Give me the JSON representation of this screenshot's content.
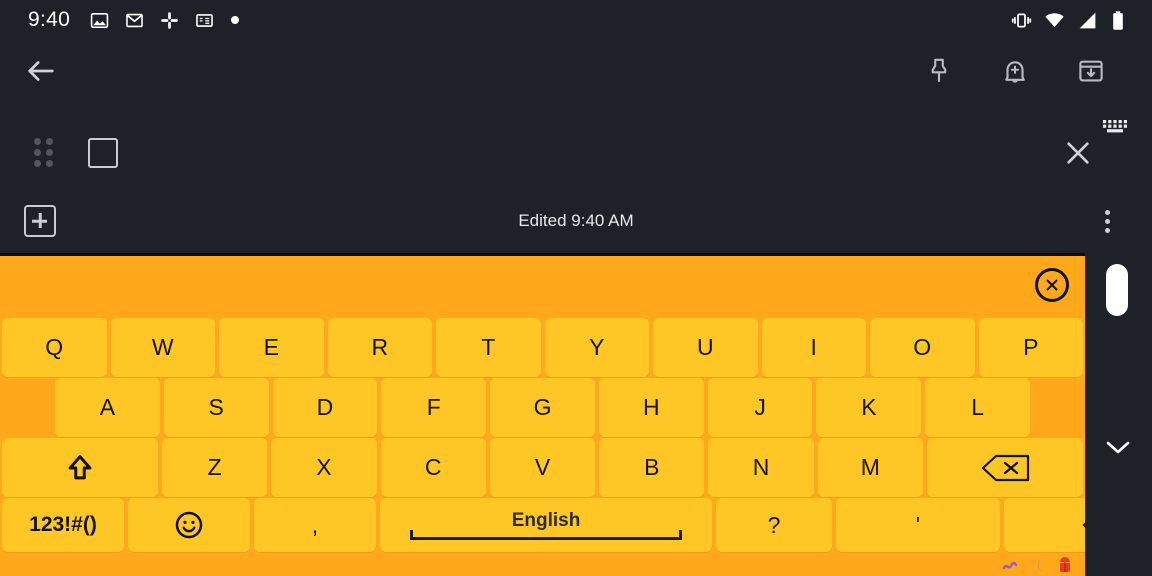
{
  "statusbar": {
    "time": "9:40",
    "left_icons": [
      "photos-icon",
      "gmail-icon",
      "slack-icon",
      "google-news-icon",
      "dot-icon"
    ],
    "right_icons": [
      "vibrate-icon",
      "wifi-icon",
      "cellular-signal-icon",
      "battery-icon"
    ]
  },
  "appbar": {
    "back_icon": "back-arrow-icon",
    "actions": [
      "pin-icon",
      "add-reminder-bell-icon",
      "archive-icon"
    ]
  },
  "list_row": {
    "drag_handle": "drag-handle-icon",
    "checkbox_checked": false,
    "close_icon": "close-icon",
    "keyboard_indicator": "keyboard-icon"
  },
  "edited_bar": {
    "add_label": "add-box-icon",
    "edited_text": "Edited 9:40 AM",
    "overflow_icon": "more-vertical-icon"
  },
  "keyboard": {
    "close_label": "×",
    "rows": [
      [
        "Q",
        "W",
        "E",
        "R",
        "T",
        "Y",
        "U",
        "I",
        "O",
        "P"
      ],
      [
        "A",
        "S",
        "D",
        "F",
        "G",
        "H",
        "J",
        "K",
        "L"
      ],
      [
        "Z",
        "X",
        "C",
        "V",
        "B",
        "N",
        "M"
      ]
    ],
    "shift_label": "shift-icon",
    "backspace_label": "backspace-icon",
    "bottom_row": {
      "symbols": "123!#()",
      "emoji": "☺",
      "comma": ",",
      "space_label": "English",
      "question": "?",
      "apostrophe": "'",
      "enter": "enter-icon"
    },
    "footer_icons": [
      "squiggle-icon",
      "moon-icon",
      "android-bug-icon"
    ],
    "colors": {
      "background": "#ffa81c",
      "key": "#ffc726",
      "key_text": "#141414"
    }
  },
  "right_strip": {
    "scrollbar": "scroll-thumb",
    "chevron": "chevron-down-icon"
  }
}
